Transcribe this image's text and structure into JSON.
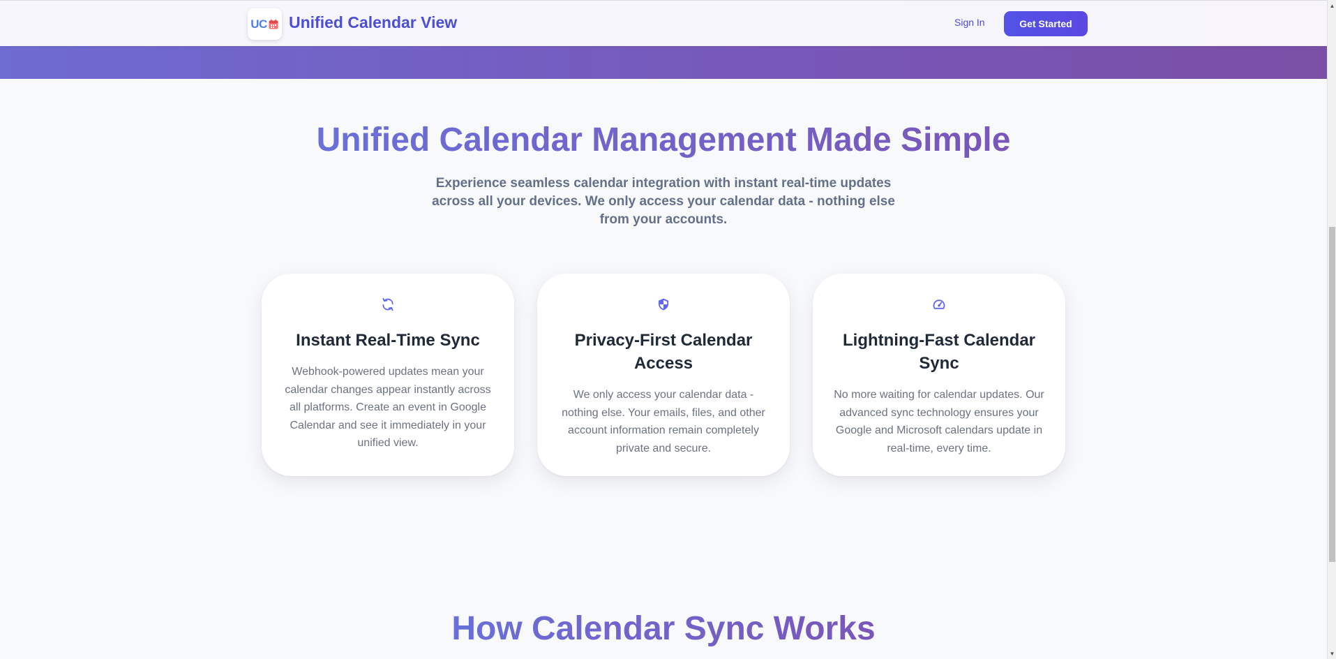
{
  "header": {
    "logo_text": "UC",
    "brand_title": "Unified Calendar View",
    "signin_label": "Sign In",
    "get_started_label": "Get Started"
  },
  "hero": {
    "title": "Unified Calendar Management Made Simple",
    "subtitle": "Experience seamless calendar integration with instant real-time updates across all your devices. We only access your calendar data - nothing else from your accounts."
  },
  "features": [
    {
      "icon": "sync-icon",
      "title": "Instant Real-Time Sync",
      "description": "Webhook-powered updates mean your calendar changes appear instantly across all platforms. Create an event in Google Calendar and see it immediately in your unified view."
    },
    {
      "icon": "shield-icon",
      "title": "Privacy-First Calendar Access",
      "description": "We only access your calendar data - nothing else. Your emails, files, and other account information remain completely private and secure."
    },
    {
      "icon": "speedometer-icon",
      "title": "Lightning-Fast Calendar Sync",
      "description": "No more waiting for calendar updates. Our advanced sync technology ensures your Google and Microsoft calendars update in real-time, every time."
    }
  ],
  "how_it_works": {
    "title": "How Calendar Sync Works"
  },
  "colors": {
    "accent": "#4f46e5",
    "gradient_start": "#6a6fd9",
    "gradient_end": "#7a56b9",
    "text_muted": "#6b7280"
  }
}
